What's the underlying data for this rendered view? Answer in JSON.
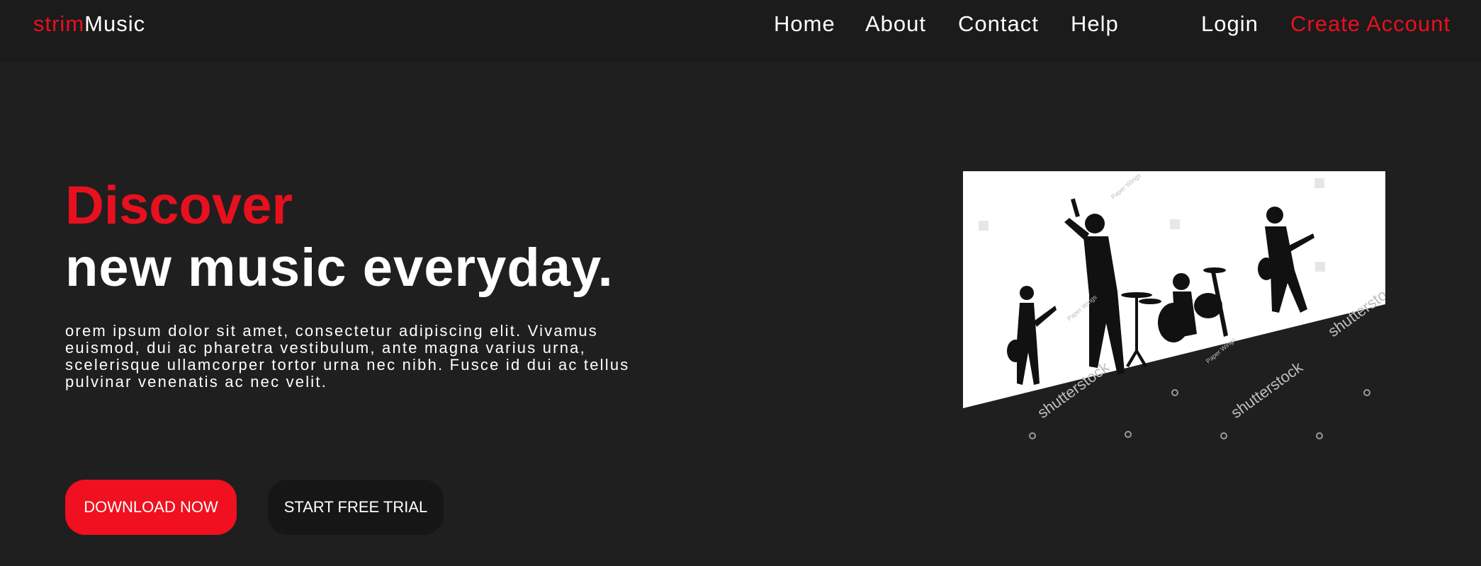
{
  "brand": {
    "prefix": "strim",
    "name": "Music"
  },
  "nav": {
    "links": [
      "Home",
      "About",
      "Contact",
      "Help"
    ],
    "login": "Login",
    "create_account": "Create Account"
  },
  "hero": {
    "title_accent": "Discover",
    "title_main": "new music everyday.",
    "body": "orem ipsum dolor sit amet, consectetur adipiscing elit. Vivamus euismod, dui ac pharetra vestibulum, ante magna varius urna, scelerisque ullamcorper tortor urna nec nibh. Fusce id dui ac tellus pulvinar venenatis ac nec velit.",
    "primary_button": "DOWNLOAD NOW",
    "secondary_button": "START FREE TRIAL",
    "image": {
      "watermark": "shutterstock",
      "watermark_credit": "Paper Wings"
    }
  },
  "colors": {
    "background": "#1f1f1f",
    "navbar": "#1b1b1b",
    "accent": "#e8101f",
    "text": "#ffffff",
    "secondary_button": "#161616"
  }
}
